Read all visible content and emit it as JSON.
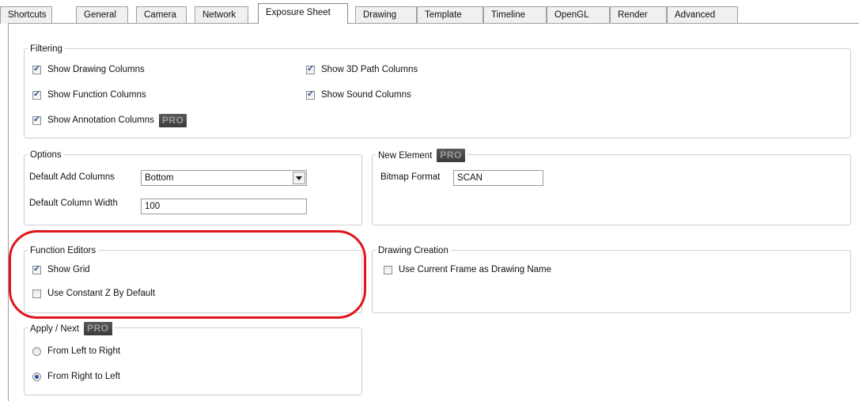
{
  "tabs": [
    {
      "label": "Shortcuts",
      "active": false
    },
    {
      "label": "General",
      "active": false
    },
    {
      "label": "Camera",
      "active": false
    },
    {
      "label": "Network",
      "active": false
    },
    {
      "label": "Exposure Sheet",
      "active": true
    },
    {
      "label": "Drawing",
      "active": false
    },
    {
      "label": "Template",
      "active": false
    },
    {
      "label": "Timeline",
      "active": false
    },
    {
      "label": "OpenGL",
      "active": false
    },
    {
      "label": "Render",
      "active": false
    },
    {
      "label": "Advanced",
      "active": false
    }
  ],
  "filtering": {
    "title": "Filtering",
    "show_drawing_columns": {
      "label": "Show Drawing Columns",
      "checked": true
    },
    "show_function_columns": {
      "label": "Show Function Columns",
      "checked": true
    },
    "show_annotation_columns": {
      "label": "Show Annotation Columns",
      "checked": true
    },
    "show_3d_path_columns": {
      "label": "Show 3D Path Columns",
      "checked": true
    },
    "show_sound_columns": {
      "label": "Show Sound Columns",
      "checked": true
    }
  },
  "pro_badge": "PRO",
  "options": {
    "title": "Options",
    "default_add_columns_label": "Default Add Columns",
    "default_add_columns_value": "Bottom",
    "default_column_width_label": "Default Column Width",
    "default_column_width_value": "100"
  },
  "new_element": {
    "title": "New Element",
    "bitmap_format_label": "Bitmap Format",
    "bitmap_format_value": "SCAN"
  },
  "function_editors": {
    "title": "Function Editors",
    "show_grid": {
      "label": "Show Grid",
      "checked": true
    },
    "use_constant_z": {
      "label": "Use Constant Z By Default",
      "checked": false
    }
  },
  "drawing_creation": {
    "title": "Drawing Creation",
    "use_current_frame": {
      "label": "Use Current Frame as Drawing Name",
      "checked": false
    }
  },
  "apply_next": {
    "title": "Apply / Next",
    "left_to_right": {
      "label": "From Left to Right",
      "selected": false
    },
    "right_to_left": {
      "label": "From Right to Left",
      "selected": true
    }
  },
  "colors": {
    "highlight": "#e0151b",
    "check": "#2b4f9e"
  }
}
